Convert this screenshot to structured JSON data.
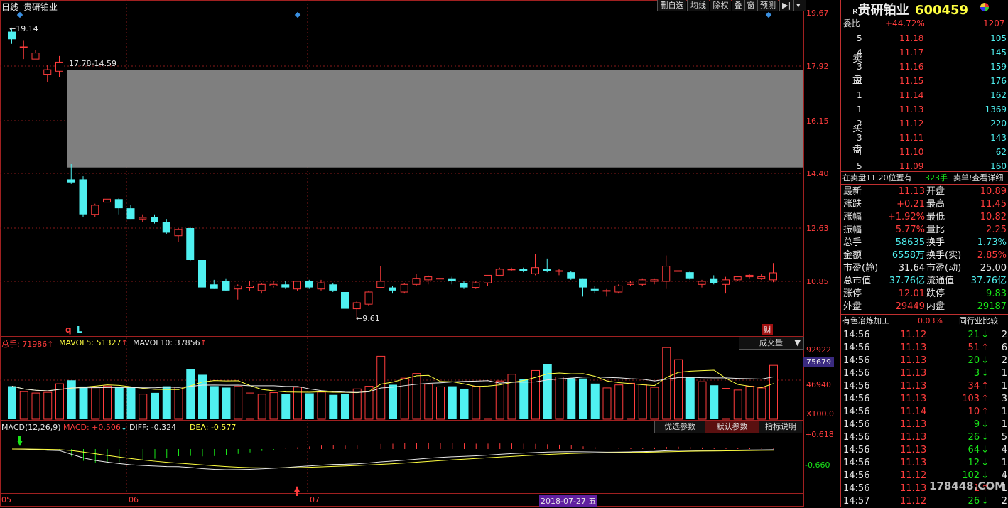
{
  "header": {
    "period": "日线",
    "name": "贵研铂业"
  },
  "toolbar": {
    "buttons": [
      "删自选",
      "均线",
      "除权",
      "叠",
      "窗",
      "预测"
    ]
  },
  "price_axis": {
    "labels": [
      "19.67",
      "17.92",
      "16.15",
      "14.40",
      "12.63",
      "10.85"
    ]
  },
  "annotations": {
    "high_label": "19.14",
    "gap_label": "17.78-14.59",
    "low_label": "9.61",
    "marker_q": "q",
    "marker_L": "L",
    "marker_cai": "财"
  },
  "volume": {
    "title": "总手: 71986",
    "mavol5": "MAVOL5: 51327",
    "mavol10": "MAVOL10: 37856",
    "dropdown": "成交量",
    "axis": [
      "92922",
      "75679",
      "46940",
      "X100.0"
    ]
  },
  "macd": {
    "title": "MACD(12,26,9)",
    "macd": "MACD: +0.506",
    "diff": "DIFF: -0.324",
    "dea": "DEA: -0.577",
    "buttons": [
      "优选参数",
      "默认参数",
      "指标说明"
    ],
    "axis": [
      "+0.618",
      "-0.660"
    ]
  },
  "time_axis": {
    "labels": [
      "05",
      "06",
      "07"
    ],
    "cursor_date": "2018-07-27 五"
  },
  "chart_data": {
    "type": "candlestick",
    "dates": [
      "05",
      "06",
      "07"
    ],
    "ohlc": [
      [
        19.05,
        19.14,
        18.65,
        18.8
      ],
      [
        18.55,
        18.75,
        18.15,
        18.55
      ],
      [
        18.15,
        18.45,
        18.15,
        18.35
      ],
      [
        17.65,
        17.95,
        17.4,
        17.8
      ],
      [
        17.75,
        18.25,
        17.55,
        18.05
      ],
      [
        14.2,
        14.7,
        14.05,
        14.1
      ],
      [
        14.2,
        14.3,
        12.95,
        13.05
      ],
      [
        13.05,
        13.4,
        12.95,
        13.35
      ],
      [
        13.45,
        13.65,
        13.25,
        13.55
      ],
      [
        13.55,
        13.6,
        13.05,
        13.25
      ],
      [
        13.25,
        13.35,
        12.9,
        12.9
      ],
      [
        12.9,
        13.05,
        12.8,
        12.95
      ],
      [
        12.95,
        13.05,
        12.75,
        12.8
      ],
      [
        12.8,
        12.9,
        12.4,
        12.45
      ],
      [
        12.35,
        12.6,
        12.15,
        12.55
      ],
      [
        12.6,
        12.65,
        11.5,
        11.55
      ],
      [
        11.55,
        11.6,
        10.7,
        10.65
      ],
      [
        10.75,
        10.9,
        10.6,
        10.6
      ],
      [
        10.85,
        10.95,
        10.55,
        10.55
      ],
      [
        10.6,
        10.75,
        10.25,
        10.7
      ],
      [
        10.65,
        10.85,
        10.55,
        10.7
      ],
      [
        10.55,
        10.8,
        10.45,
        10.75
      ],
      [
        10.7,
        10.85,
        10.65,
        10.75
      ],
      [
        10.75,
        10.85,
        10.6,
        10.65
      ],
      [
        10.6,
        10.85,
        10.55,
        10.85
      ],
      [
        10.85,
        10.9,
        10.6,
        10.65
      ],
      [
        10.6,
        10.9,
        10.55,
        10.8
      ],
      [
        10.75,
        10.8,
        10.5,
        10.55
      ],
      [
        10.5,
        10.6,
        9.97,
        9.95
      ],
      [
        9.95,
        10.2,
        9.61,
        10.15
      ],
      [
        10.1,
        10.55,
        10.05,
        10.5
      ],
      [
        10.65,
        11.35,
        10.65,
        10.85
      ],
      [
        10.65,
        10.7,
        10.45,
        10.55
      ],
      [
        10.5,
        10.8,
        10.45,
        10.75
      ],
      [
        10.75,
        11.1,
        10.7,
        10.95
      ],
      [
        10.9,
        11.05,
        10.75,
        11.0
      ],
      [
        10.95,
        11.0,
        10.9,
        10.95
      ],
      [
        10.95,
        11.0,
        10.75,
        10.85
      ],
      [
        10.8,
        10.85,
        10.6,
        10.65
      ],
      [
        10.65,
        10.85,
        10.6,
        10.8
      ],
      [
        10.8,
        11.05,
        10.7,
        11.05
      ],
      [
        11.05,
        11.3,
        11.05,
        11.25
      ],
      [
        11.25,
        11.3,
        11.2,
        11.25
      ],
      [
        11.25,
        11.3,
        11.15,
        11.2
      ],
      [
        11.1,
        11.75,
        11.05,
        11.3
      ],
      [
        11.25,
        11.6,
        11.15,
        11.2
      ],
      [
        11.2,
        11.25,
        11.05,
        11.2
      ],
      [
        11.15,
        11.2,
        10.9,
        10.95
      ],
      [
        10.95,
        10.95,
        10.35,
        10.65
      ],
      [
        10.6,
        10.7,
        10.45,
        10.55
      ],
      [
        10.55,
        10.6,
        10.35,
        10.55
      ],
      [
        10.5,
        10.75,
        10.45,
        10.7
      ],
      [
        10.75,
        10.85,
        10.7,
        10.8
      ],
      [
        10.75,
        10.95,
        10.7,
        10.9
      ],
      [
        10.85,
        10.95,
        10.75,
        10.9
      ],
      [
        10.85,
        11.7,
        10.6,
        11.35
      ],
      [
        11.2,
        11.35,
        11.15,
        11.2
      ],
      [
        11.15,
        11.2,
        10.9,
        10.95
      ],
      [
        10.75,
        10.9,
        10.65,
        10.85
      ],
      [
        10.95,
        11.05,
        10.75,
        10.8
      ],
      [
        10.75,
        11.0,
        10.45,
        10.9
      ],
      [
        10.9,
        11.0,
        10.85,
        11.0
      ],
      [
        11.0,
        11.1,
        10.95,
        11.05
      ],
      [
        10.95,
        11.1,
        10.9,
        11.0
      ],
      [
        10.9,
        11.45,
        10.82,
        11.13
      ]
    ],
    "volume": [
      441,
      368,
      350,
      359,
      473,
      519,
      437,
      423,
      443,
      435,
      425,
      335,
      352,
      440,
      430,
      670,
      593,
      442,
      422,
      438,
      350,
      334,
      355,
      340,
      428,
      346,
      362,
      325,
      332,
      405,
      440,
      840,
      460,
      548,
      610,
      468,
      432,
      440,
      408,
      440,
      498,
      510,
      600,
      534,
      650,
      735,
      564,
      546,
      543,
      476,
      418,
      458,
      480,
      466,
      426,
      956,
      795,
      564,
      501,
      453,
      412,
      390,
      441,
      418,
      719
    ]
  },
  "quote": {
    "title": "贵研铂业",
    "code": "600459",
    "r_prefix": "R",
    "weibi_label": "委比",
    "weibi_value": "+44.72%",
    "weicha": "1207",
    "sell_label": [
      "卖",
      "盘"
    ],
    "buy_label": [
      "买",
      "盘"
    ],
    "sells": [
      {
        "lvl": "5",
        "price": "11.18",
        "vol": "105"
      },
      {
        "lvl": "4",
        "price": "11.17",
        "vol": "145"
      },
      {
        "lvl": "3",
        "price": "11.16",
        "vol": "159"
      },
      {
        "lvl": "2",
        "price": "11.15",
        "vol": "176"
      },
      {
        "lvl": "1",
        "price": "11.14",
        "vol": "162"
      }
    ],
    "buys": [
      {
        "lvl": "1",
        "price": "11.13",
        "vol": "1369"
      },
      {
        "lvl": "2",
        "price": "11.12",
        "vol": "220"
      },
      {
        "lvl": "3",
        "price": "11.11",
        "vol": "143"
      },
      {
        "lvl": "4",
        "price": "11.10",
        "vol": "62"
      },
      {
        "lvl": "5",
        "price": "11.09",
        "vol": "160"
      }
    ],
    "notice_left": "在卖盘11.20位置有",
    "notice_mid": "323手",
    "notice_right": "卖单!查看详细",
    "stats": [
      {
        "l1": "最新",
        "v1": "11.13",
        "l2": "开盘",
        "v2": "10.89"
      },
      {
        "l1": "涨跌",
        "v1": "+0.21",
        "l2": "最高",
        "v2": "11.45"
      },
      {
        "l1": "涨幅",
        "v1": "+1.92%",
        "l2": "最低",
        "v2": "10.82"
      },
      {
        "l1": "振幅",
        "v1": "5.77%",
        "l2": "量比",
        "v2": "2.25"
      },
      {
        "l1": "总手",
        "v1": "58635",
        "l2": "换手",
        "v2": "1.73%"
      },
      {
        "l1": "金额",
        "v1": "6558万",
        "l2": "换手(实)",
        "v2": "2.85%"
      },
      {
        "l1": "市盈(静)",
        "v1": "31.64",
        "l2": "市盈(动)",
        "v2": "25.00"
      },
      {
        "l1": "总市值",
        "v1": "37.76亿",
        "l2": "流通值",
        "v2": "37.76亿"
      },
      {
        "l1": "涨停",
        "v1": "12.01",
        "l2": "跌停",
        "v2": "9.83"
      },
      {
        "l1": "外盘",
        "v1": "29449",
        "l2": "内盘",
        "v2": "29187"
      }
    ],
    "sector": "有色冶炼加工",
    "sector_pct": "0.03%",
    "sector_compare": "同行业比较",
    "ticks": [
      {
        "t": "14:56",
        "p": "11.12",
        "v": "21",
        "dir": "down",
        "n": "2"
      },
      {
        "t": "14:56",
        "p": "11.13",
        "v": "51",
        "dir": "up",
        "n": "6"
      },
      {
        "t": "14:56",
        "p": "11.13",
        "v": "20",
        "dir": "down",
        "n": "2"
      },
      {
        "t": "14:56",
        "p": "11.13",
        "v": "3",
        "dir": "down",
        "n": "1"
      },
      {
        "t": "14:56",
        "p": "11.13",
        "v": "34",
        "dir": "up",
        "n": "1"
      },
      {
        "t": "14:56",
        "p": "11.13",
        "v": "103",
        "dir": "up",
        "n": "3"
      },
      {
        "t": "14:56",
        "p": "11.14",
        "v": "10",
        "dir": "up",
        "n": "1"
      },
      {
        "t": "14:56",
        "p": "11.13",
        "v": "9",
        "dir": "down",
        "n": "1"
      },
      {
        "t": "14:56",
        "p": "11.13",
        "v": "26",
        "dir": "down",
        "n": "5"
      },
      {
        "t": "14:56",
        "p": "11.13",
        "v": "64",
        "dir": "down",
        "n": "4"
      },
      {
        "t": "14:56",
        "p": "11.13",
        "v": "12",
        "dir": "down",
        "n": "1"
      },
      {
        "t": "14:56",
        "p": "11.12",
        "v": "102",
        "dir": "down",
        "n": "4"
      },
      {
        "t": "14:56",
        "p": "11.13",
        "v": "1",
        "dir": "up",
        "n": "1"
      },
      {
        "t": "14:57",
        "p": "11.12",
        "v": "26",
        "dir": "down",
        "n": "2"
      }
    ]
  },
  "watermark": "178448.COM"
}
